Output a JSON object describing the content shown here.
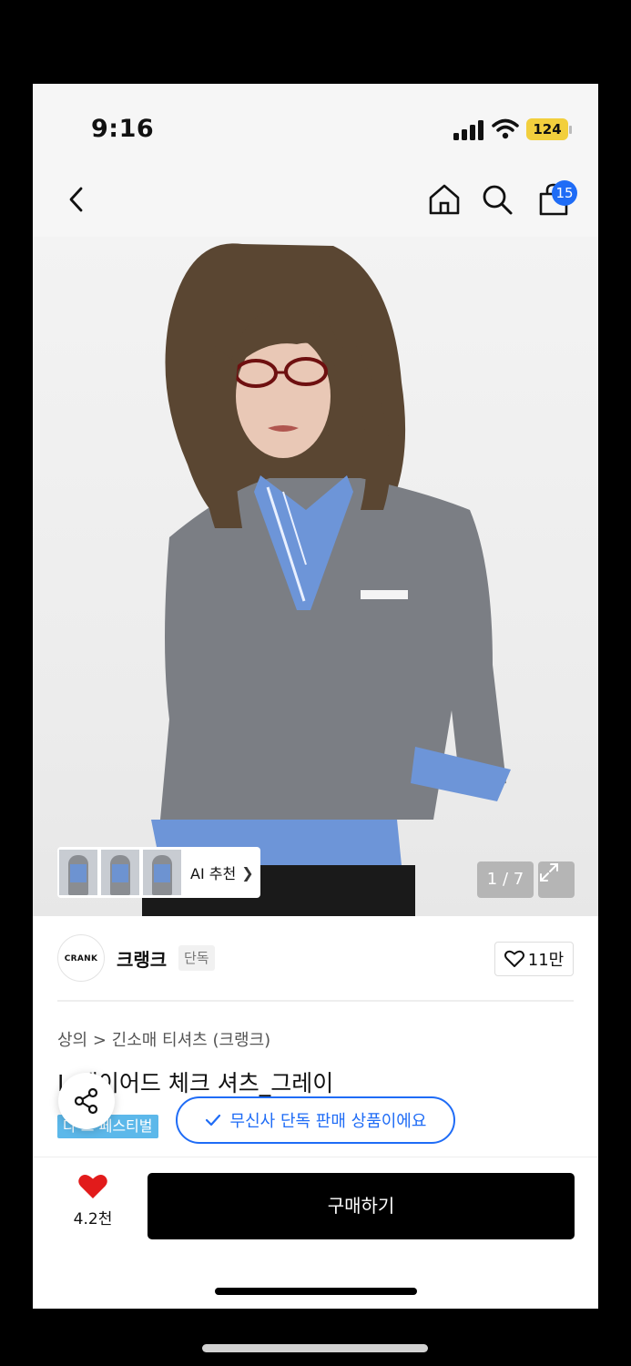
{
  "status_bar": {
    "time": "9:16",
    "battery": "124"
  },
  "header": {
    "cart_badge": "15"
  },
  "gallery": {
    "ai_label": "AI 추천",
    "counter": "1 / 7"
  },
  "brand": {
    "logo_text": "CRANK",
    "name": "크랭크",
    "tag": "단독",
    "likes": "11만"
  },
  "product": {
    "breadcrumb": "상의 > 긴소매 티셔츠 (크랭크)",
    "title": "L    레이어드 체크 셔츠_그레이",
    "festival_tag": "다 크 페스티벌",
    "exclusive_notice": "무신사 단독 판매 상품이에요"
  },
  "bottom_bar": {
    "heart_count": "4.2천",
    "buy_label": "구매하기"
  },
  "colors": {
    "accent_blue": "#1f6cf6",
    "heart_red": "#e21b1b",
    "tag_blue": "#5cb8ea"
  }
}
